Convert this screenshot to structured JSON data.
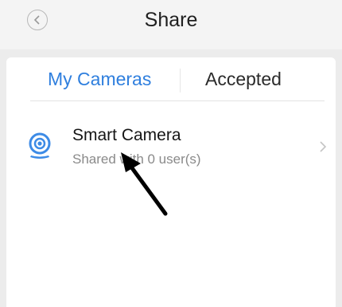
{
  "header": {
    "title": "Share",
    "back_icon": "chevron-left-icon"
  },
  "tabs": [
    {
      "label": "My Cameras",
      "active": true,
      "color": "#2f7fde"
    },
    {
      "label": "Accepted",
      "active": false
    }
  ],
  "cameras": [
    {
      "name": "Smart Camera",
      "subtitle": "Shared with 0 user(s)",
      "icon": "camera-icon",
      "icon_color": "#3d8be6"
    }
  ],
  "annotation": {
    "icon": "arrow-annotation",
    "color": "#000000"
  }
}
